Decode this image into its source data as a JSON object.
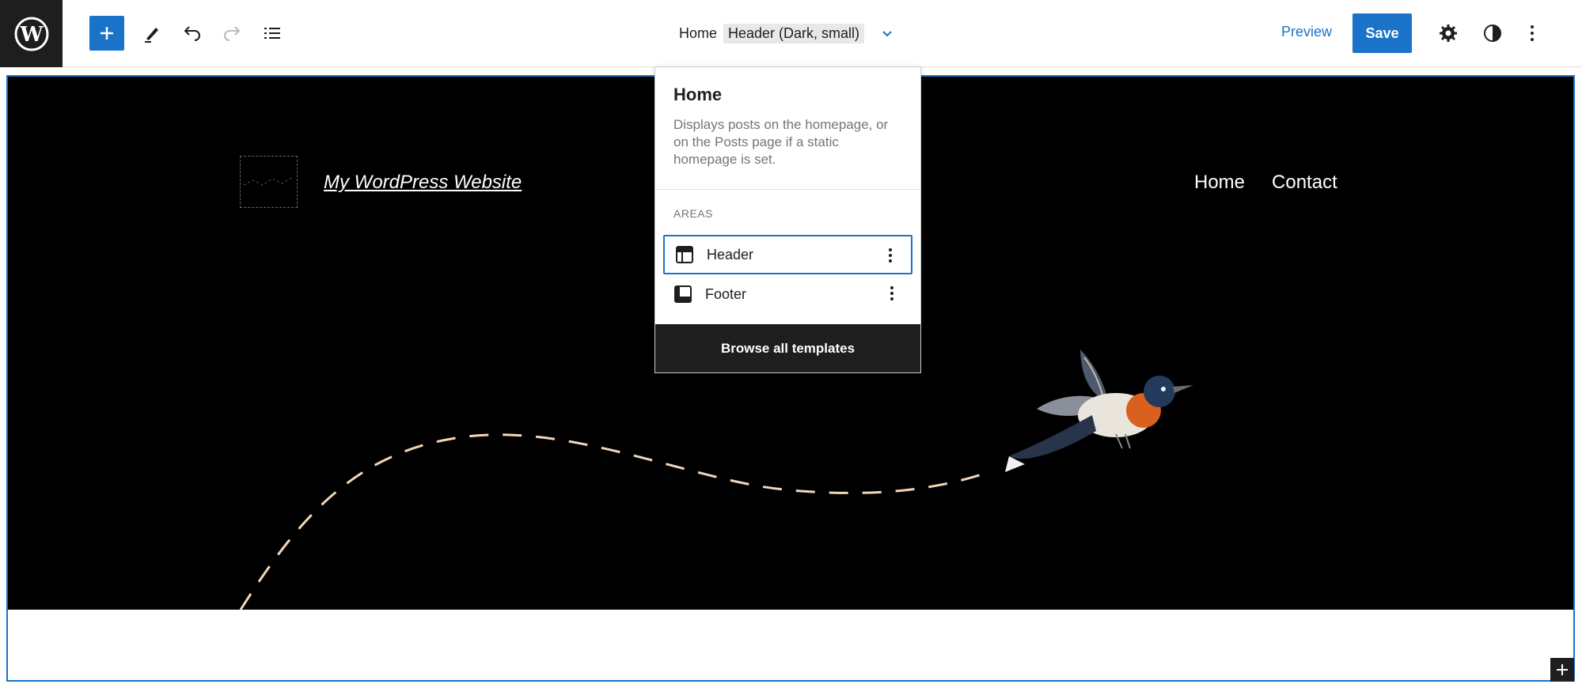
{
  "toolbar": {
    "template_name": "Home",
    "template_part": "Header (Dark, small)",
    "preview_label": "Preview",
    "save_label": "Save"
  },
  "site": {
    "title": "My WordPress Website",
    "nav_items": [
      "Home",
      "Contact"
    ]
  },
  "popover": {
    "title": "Home",
    "description": "Displays posts on the homepage, or on the Posts page if a static homepage is set.",
    "areas_label": "AREAS",
    "areas": [
      {
        "label": "Header",
        "icon": "header-layout-icon",
        "active": true
      },
      {
        "label": "Footer",
        "icon": "footer-layout-icon",
        "active": false
      }
    ],
    "browse_label": "Browse all templates"
  },
  "colors": {
    "accent": "#1a73c8",
    "dark_bg": "#000000",
    "path_color": "#f3d6b8"
  }
}
